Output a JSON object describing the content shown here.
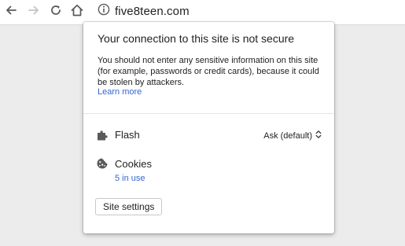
{
  "browser": {
    "url": "five8teen.com",
    "icons": {
      "back": "back-arrow-icon",
      "forward": "forward-arrow-icon",
      "reload": "reload-icon",
      "home": "home-icon",
      "site_info": "info-icon"
    }
  },
  "site_info_popup": {
    "title": "Your connection to this site is not secure",
    "description": "You should not enter any sensitive information on this site (for example, passwords or credit cards), because it could be stolen by attackers.",
    "learn_more": "Learn more",
    "permissions": {
      "flash": {
        "label": "Flash",
        "value": "Ask (default)",
        "icon": "puzzle-icon"
      },
      "cookies": {
        "label": "Cookies",
        "count_text": "5 in use",
        "icon": "cookie-icon"
      }
    },
    "site_settings_label": "Site settings"
  },
  "colors": {
    "link": "#3367d6",
    "icon_gray": "#5a5a5a",
    "disabled_gray": "#c4c4c4"
  }
}
